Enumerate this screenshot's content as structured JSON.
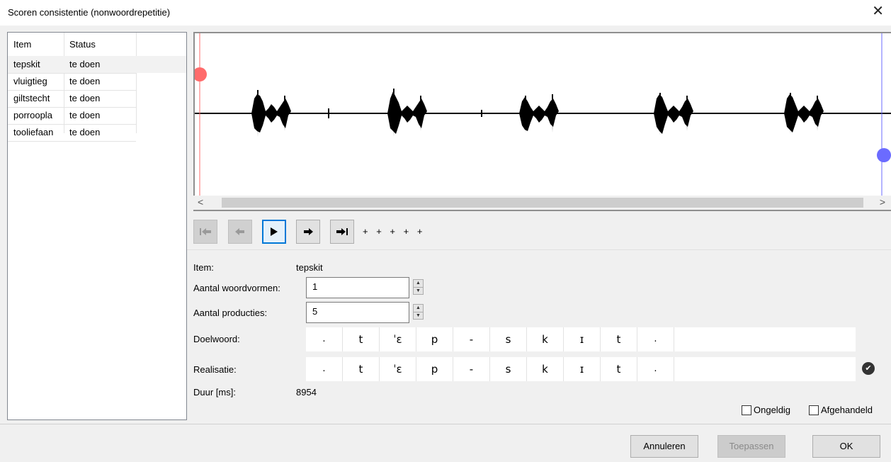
{
  "window": {
    "title": "Scoren consistentie (nonwoordrepetitie)",
    "close": "✕"
  },
  "list": {
    "headers": [
      "Item",
      "Status"
    ],
    "rows": [
      {
        "item": "tepskit",
        "status": "te doen"
      },
      {
        "item": "vluigtieg",
        "status": "te doen"
      },
      {
        "item": "giltstecht",
        "status": "te doen"
      },
      {
        "item": "porroopla",
        "status": "te doen"
      },
      {
        "item": "tooliefaan",
        "status": "te doen"
      }
    ]
  },
  "scrollbar": {
    "left": "<",
    "right": ">"
  },
  "toolbar": {
    "plus_markers": "+ + + + +"
  },
  "form": {
    "item_label": "Item:",
    "item_value": "tepskit",
    "woordvormen_label": "Aantal woordvormen:",
    "woordvormen_value": "1",
    "producties_label": "Aantal producties:",
    "producties_value": "5",
    "doelwoord_label": "Doelwoord:",
    "realisatie_label": "Realisatie:",
    "duur_label": "Duur [ms]:",
    "duur_value": "8954",
    "doelwoord": [
      ".",
      "t",
      "ˈɛ",
      "p",
      "-",
      "s",
      "k",
      "ɪ",
      "t",
      "."
    ],
    "realisatie": [
      ".",
      "t",
      "ˈɛ",
      "p",
      "-",
      "s",
      "k",
      "ɪ",
      "t",
      "."
    ]
  },
  "checkboxes": {
    "ongeldig": "Ongeldig",
    "afgehandeld": "Afgehandeld"
  },
  "buttons": {
    "cancel": "Annuleren",
    "apply": "Toepassen",
    "ok": "OK"
  },
  "colors": {
    "accent": "#0078d7",
    "start_marker": "#ff6b6b",
    "end_marker": "#6b6bff"
  }
}
